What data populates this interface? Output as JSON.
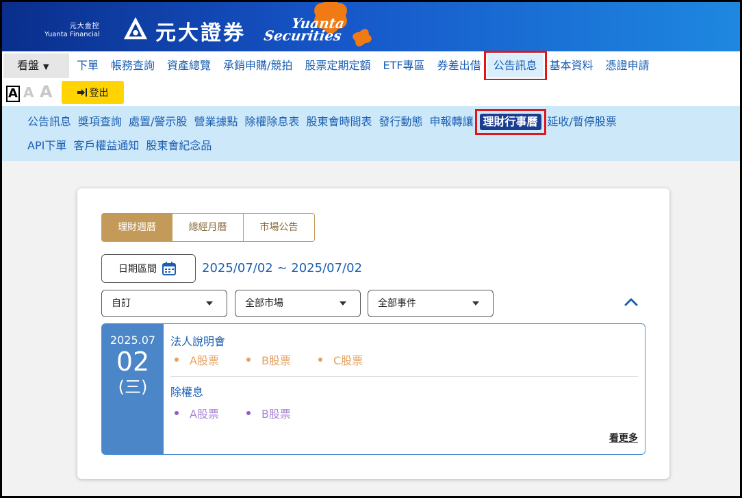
{
  "brand": {
    "group_zh": "元大金控",
    "group_en": "Yuanta Financial",
    "title_zh": "元大證券",
    "title_en_1": "Yuanta",
    "title_en_2": "Securities"
  },
  "topnav": {
    "items": [
      "看盤",
      "下單",
      "帳務查詢",
      "資產總覽",
      "承銷申購/競拍",
      "股票定期定額",
      "ETF專區",
      "券差出借",
      "公告訊息",
      "基本資料",
      "憑證申請"
    ],
    "active_index": 8
  },
  "toolbar": {
    "font_sizes": [
      "A",
      "A",
      "A"
    ],
    "logout_label": "登出"
  },
  "subnav": {
    "row1": [
      "公告訊息",
      "獎項查詢",
      "處置/警示股",
      "營業據點",
      "除權除息表",
      "股東會時間表",
      "發行動態",
      "申報轉讓",
      "理財行事曆",
      "延收/暫停股票"
    ],
    "row2": [
      "API下單",
      "客戶權益通知",
      "股東會紀念品"
    ],
    "active_label": "理財行事曆"
  },
  "calendar": {
    "tabs": [
      "理財週曆",
      "總經月曆",
      "市場公告"
    ],
    "active_tab": 0,
    "date_button_label": "日期區間",
    "date_range": "2025/07/02 ~ 2025/07/02",
    "filters": [
      "自訂",
      "全部市場",
      "全部事件"
    ],
    "event": {
      "year_month": "2025.07",
      "day": "02",
      "weekday": "(三)",
      "groups": [
        {
          "title": "法人說明會",
          "items": [
            "A股票",
            "B股票",
            "C股票"
          ]
        },
        {
          "title": "除權息",
          "items": [
            "A股票",
            "B股票"
          ]
        }
      ],
      "more_label": "看更多"
    }
  },
  "colors": {
    "nav_link": "#1a5fb4",
    "highlight": "#e0161b",
    "tab_gold": "#c49a5a",
    "event_date_bg": "#4a86c8",
    "logout_yellow": "#ffd400"
  }
}
